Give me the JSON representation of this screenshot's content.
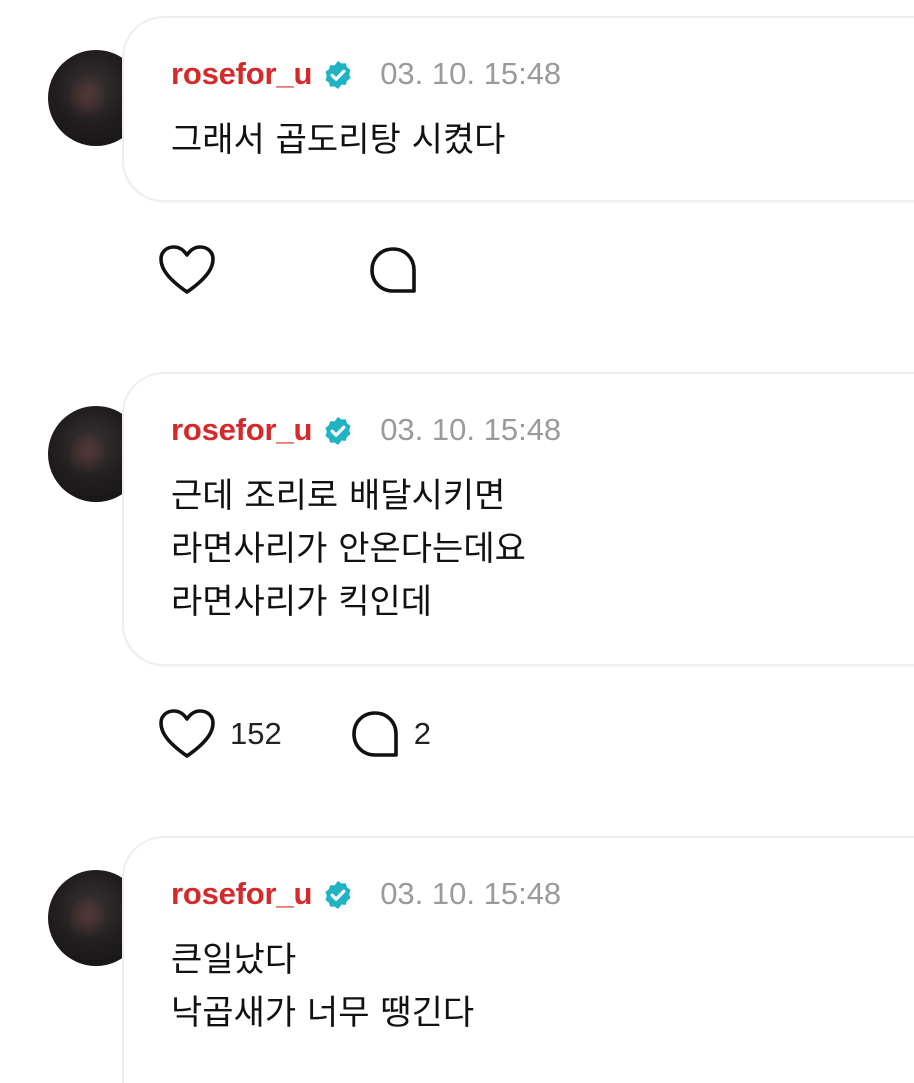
{
  "posts": [
    {
      "username": "rosefor_u",
      "timestamp": "03. 10. 15:48",
      "lines": [
        "그래서 곱도리탕 시켰다"
      ],
      "likes": "",
      "comments": ""
    },
    {
      "username": "rosefor_u",
      "timestamp": "03. 10. 15:48",
      "lines": [
        "근데 조리로 배달시키면",
        "라면사리가 안온다는데요",
        "라면사리가 킥인데"
      ],
      "likes": "152",
      "comments": "2"
    },
    {
      "username": "rosefor_u",
      "timestamp": "03. 10. 15:48",
      "lines": [
        "큰일났다",
        "낙곱새가 너무 땡긴다"
      ],
      "likes": "",
      "comments": ""
    }
  ],
  "icons": {
    "verified": "verified-badge-icon",
    "like": "heart-icon",
    "comment": "comment-bubble-icon"
  },
  "colors": {
    "username": "#d42a2a",
    "verified": "#1fb3c4",
    "timestamp": "#9a9a9a"
  }
}
